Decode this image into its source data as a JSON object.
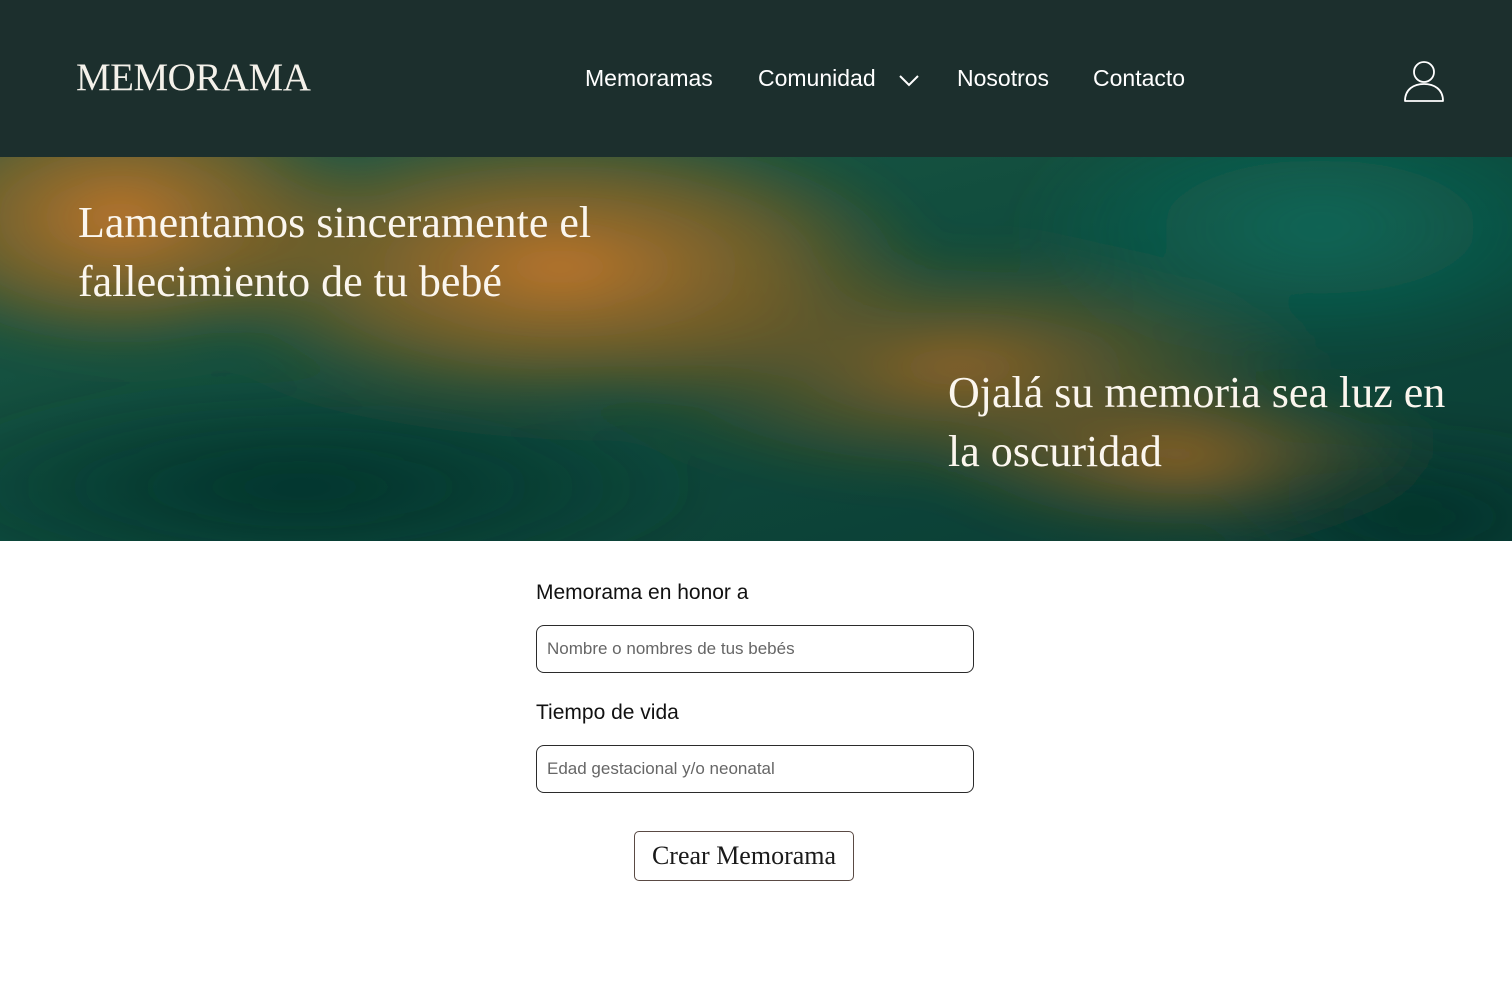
{
  "header": {
    "logo": "MEMORAMA",
    "nav": {
      "memoramas": "Memoramas",
      "comunidad": "Comunidad",
      "nosotros": "Nosotros",
      "contacto": "Contacto"
    },
    "icons": {
      "dropdown": "chevron-down-icon",
      "account": "user-icon"
    }
  },
  "hero": {
    "title": "Lamentamos sinceramente el fallecimiento de tu bebé",
    "subtitle": "Ojalá su memoria sea luz en  la oscuridad"
  },
  "form": {
    "honor_label": "Memorama en honor a",
    "honor_placeholder": "Nombre o nombres de tus bebés",
    "tiempo_label": "Tiempo de vida",
    "tiempo_placeholder": "Edad gestacional y/o neonatal",
    "submit_label": "Crear Memorama"
  },
  "colors": {
    "header_bg": "#1c2f2d",
    "hero_green": "#0f4a3e",
    "hero_orange": "#b8702a",
    "text_light": "#fbf6ee"
  }
}
